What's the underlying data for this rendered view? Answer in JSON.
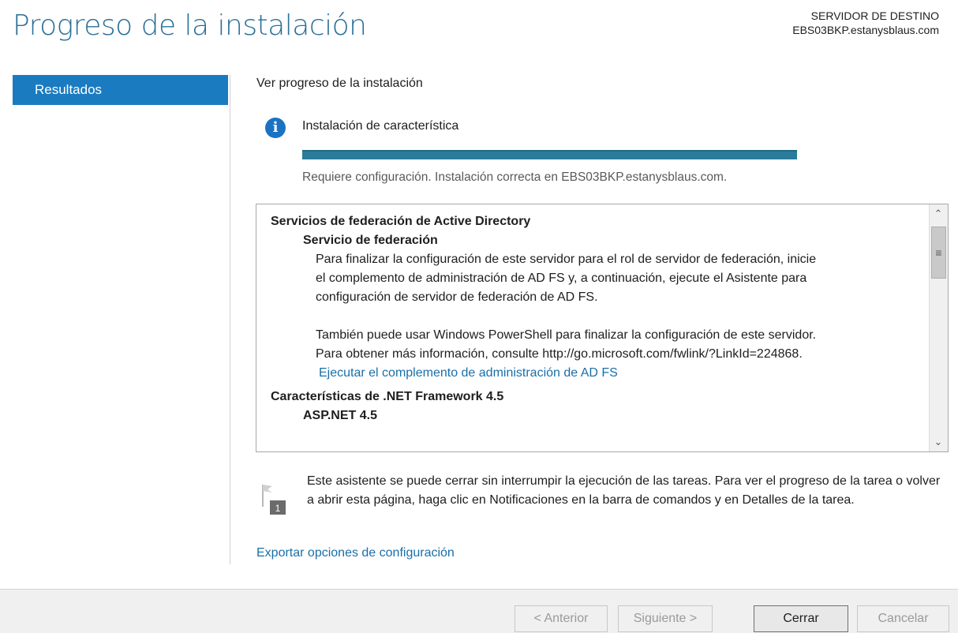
{
  "header": {
    "title": "Progreso de la instalación",
    "server_caption": "SERVIDOR DE DESTINO",
    "server_name": "EBS03BKP.estanysblaus.com"
  },
  "nav": {
    "items": [
      {
        "label": "Resultados",
        "selected": true
      }
    ]
  },
  "main": {
    "section_title": "Ver progreso de la instalación",
    "status": {
      "icon": "info-icon",
      "title": "Instalación de característica",
      "progress_fraction": 1.0,
      "text": "Requiere configuración. Instalación correcta en EBS03BKP.estanysblaus.com."
    },
    "results": {
      "group1_title": "Servicios de federación de Active Directory",
      "group1_sub": "Servicio de federación",
      "group1_para1_line1": "Para finalizar la configuración de este servidor para el rol de servidor de federación, inicie",
      "group1_para1_line2": "el complemento de administración de AD FS y, a continuación, ejecute el Asistente para",
      "group1_para1_line3": "configuración de servidor de federación de AD FS.",
      "group1_para2_line1": "También puede usar Windows PowerShell para finalizar la configuración de este servidor.",
      "group1_para2_line2": "Para obtener más información, consulte http://go.microsoft.com/fwlink/?LinkId=224868.",
      "group1_link": "Ejecutar el complemento de administración de AD FS",
      "group2_title": "Características de .NET Framework 4.5",
      "group2_sub": "ASP.NET 4.5"
    },
    "notice": {
      "badge": "1",
      "text": "Este asistente se puede cerrar sin interrumpir la ejecución de las tareas. Para ver el progreso de la tarea o volver a abrir esta página, haga clic en Notificaciones en la barra de comandos y en Detalles de la tarea."
    },
    "export_link": "Exportar opciones de configuración"
  },
  "footer": {
    "back_label": "< Anterior",
    "next_label": "Siguiente >",
    "close_label": "Cerrar",
    "cancel_label": "Cancelar"
  },
  "colors": {
    "accent": "#1a7bc1",
    "title": "#2a6f97",
    "progress": "#2a7c9a",
    "link": "#1a6fa8"
  }
}
